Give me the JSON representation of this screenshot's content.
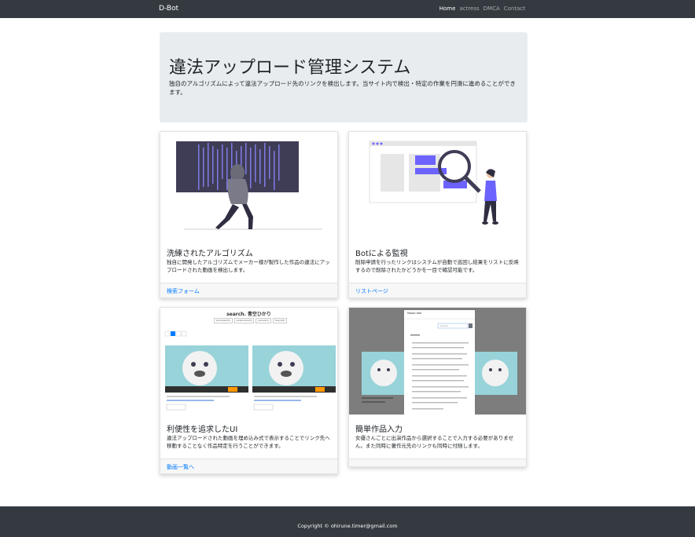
{
  "navbar": {
    "brand": "D-Bot",
    "links": [
      {
        "label": "Home",
        "active": true
      },
      {
        "label": "actress",
        "active": false
      },
      {
        "label": "DMCA",
        "active": false
      },
      {
        "label": "Contact",
        "active": false
      }
    ]
  },
  "hero": {
    "title": "違法アップロード管理システム",
    "lead": "独自のアルゴリズムによって違法アップロード先のリンクを検出します。当サイト内で検出・特定の作業を円滑に進めることができます。"
  },
  "cards": [
    {
      "title": "洗練されたアルゴリズム",
      "text": "独自に開発したアルゴリズムでメーカー様が製作した作品の違法にアップロードされた動画を検出します。",
      "link": "検索フォーム"
    },
    {
      "title": "Botによる監視",
      "text": "削除申請を行ったリンクはシステムが自動で巡回し結果をリストに反映するので削除されたかどうかを一目で確認可能です。",
      "link": "リストページ"
    },
    {
      "title": "利便性を追求したUI",
      "text": "違法アップロードされた動画を埋め込み式で表示することでリンク先へ移動することなく作品特定を行うことができます。",
      "link": "動画一覧へ",
      "screenshot": {
        "heading": "search. 青空ひかり",
        "tags": [
          "javmoster(20)",
          "avidemobin(23)",
          "javmost(1)",
          "tokyo(16)"
        ]
      }
    },
    {
      "title": "簡単作品入力",
      "text": "女優さんごとに出演作品から選択することで入力する必要がありません。また同時に著作元先のリンクも同時に付随します。",
      "modal": {
        "title": "Modal title",
        "search_placeholder": "Search"
      }
    }
  ],
  "footer": {
    "copyright": "Copyright © ohirune.timer@gmail.com"
  },
  "colors": {
    "navbar": "#343a40",
    "jumbotron": "#e9ecef",
    "link": "#007bff",
    "accent_purple": "#6c63ff",
    "screen_dark": "#3f3d56"
  }
}
